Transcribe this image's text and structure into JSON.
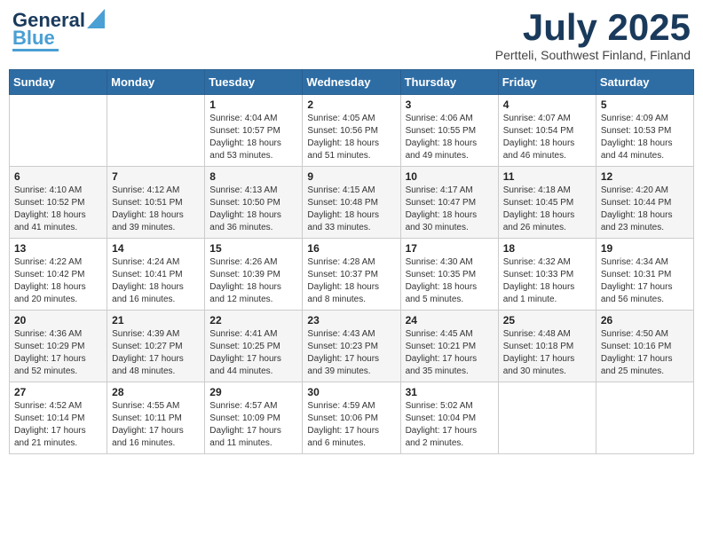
{
  "logo": {
    "line1": "General",
    "line2": "Blue"
  },
  "title": "July 2025",
  "subtitle": "Pertteli, Southwest Finland, Finland",
  "days_header": [
    "Sunday",
    "Monday",
    "Tuesday",
    "Wednesday",
    "Thursday",
    "Friday",
    "Saturday"
  ],
  "weeks": [
    [
      {
        "day": "",
        "info": ""
      },
      {
        "day": "",
        "info": ""
      },
      {
        "day": "1",
        "info": "Sunrise: 4:04 AM\nSunset: 10:57 PM\nDaylight: 18 hours\nand 53 minutes."
      },
      {
        "day": "2",
        "info": "Sunrise: 4:05 AM\nSunset: 10:56 PM\nDaylight: 18 hours\nand 51 minutes."
      },
      {
        "day": "3",
        "info": "Sunrise: 4:06 AM\nSunset: 10:55 PM\nDaylight: 18 hours\nand 49 minutes."
      },
      {
        "day": "4",
        "info": "Sunrise: 4:07 AM\nSunset: 10:54 PM\nDaylight: 18 hours\nand 46 minutes."
      },
      {
        "day": "5",
        "info": "Sunrise: 4:09 AM\nSunset: 10:53 PM\nDaylight: 18 hours\nand 44 minutes."
      }
    ],
    [
      {
        "day": "6",
        "info": "Sunrise: 4:10 AM\nSunset: 10:52 PM\nDaylight: 18 hours\nand 41 minutes."
      },
      {
        "day": "7",
        "info": "Sunrise: 4:12 AM\nSunset: 10:51 PM\nDaylight: 18 hours\nand 39 minutes."
      },
      {
        "day": "8",
        "info": "Sunrise: 4:13 AM\nSunset: 10:50 PM\nDaylight: 18 hours\nand 36 minutes."
      },
      {
        "day": "9",
        "info": "Sunrise: 4:15 AM\nSunset: 10:48 PM\nDaylight: 18 hours\nand 33 minutes."
      },
      {
        "day": "10",
        "info": "Sunrise: 4:17 AM\nSunset: 10:47 PM\nDaylight: 18 hours\nand 30 minutes."
      },
      {
        "day": "11",
        "info": "Sunrise: 4:18 AM\nSunset: 10:45 PM\nDaylight: 18 hours\nand 26 minutes."
      },
      {
        "day": "12",
        "info": "Sunrise: 4:20 AM\nSunset: 10:44 PM\nDaylight: 18 hours\nand 23 minutes."
      }
    ],
    [
      {
        "day": "13",
        "info": "Sunrise: 4:22 AM\nSunset: 10:42 PM\nDaylight: 18 hours\nand 20 minutes."
      },
      {
        "day": "14",
        "info": "Sunrise: 4:24 AM\nSunset: 10:41 PM\nDaylight: 18 hours\nand 16 minutes."
      },
      {
        "day": "15",
        "info": "Sunrise: 4:26 AM\nSunset: 10:39 PM\nDaylight: 18 hours\nand 12 minutes."
      },
      {
        "day": "16",
        "info": "Sunrise: 4:28 AM\nSunset: 10:37 PM\nDaylight: 18 hours\nand 8 minutes."
      },
      {
        "day": "17",
        "info": "Sunrise: 4:30 AM\nSunset: 10:35 PM\nDaylight: 18 hours\nand 5 minutes."
      },
      {
        "day": "18",
        "info": "Sunrise: 4:32 AM\nSunset: 10:33 PM\nDaylight: 18 hours\nand 1 minute."
      },
      {
        "day": "19",
        "info": "Sunrise: 4:34 AM\nSunset: 10:31 PM\nDaylight: 17 hours\nand 56 minutes."
      }
    ],
    [
      {
        "day": "20",
        "info": "Sunrise: 4:36 AM\nSunset: 10:29 PM\nDaylight: 17 hours\nand 52 minutes."
      },
      {
        "day": "21",
        "info": "Sunrise: 4:39 AM\nSunset: 10:27 PM\nDaylight: 17 hours\nand 48 minutes."
      },
      {
        "day": "22",
        "info": "Sunrise: 4:41 AM\nSunset: 10:25 PM\nDaylight: 17 hours\nand 44 minutes."
      },
      {
        "day": "23",
        "info": "Sunrise: 4:43 AM\nSunset: 10:23 PM\nDaylight: 17 hours\nand 39 minutes."
      },
      {
        "day": "24",
        "info": "Sunrise: 4:45 AM\nSunset: 10:21 PM\nDaylight: 17 hours\nand 35 minutes."
      },
      {
        "day": "25",
        "info": "Sunrise: 4:48 AM\nSunset: 10:18 PM\nDaylight: 17 hours\nand 30 minutes."
      },
      {
        "day": "26",
        "info": "Sunrise: 4:50 AM\nSunset: 10:16 PM\nDaylight: 17 hours\nand 25 minutes."
      }
    ],
    [
      {
        "day": "27",
        "info": "Sunrise: 4:52 AM\nSunset: 10:14 PM\nDaylight: 17 hours\nand 21 minutes."
      },
      {
        "day": "28",
        "info": "Sunrise: 4:55 AM\nSunset: 10:11 PM\nDaylight: 17 hours\nand 16 minutes."
      },
      {
        "day": "29",
        "info": "Sunrise: 4:57 AM\nSunset: 10:09 PM\nDaylight: 17 hours\nand 11 minutes."
      },
      {
        "day": "30",
        "info": "Sunrise: 4:59 AM\nSunset: 10:06 PM\nDaylight: 17 hours\nand 6 minutes."
      },
      {
        "day": "31",
        "info": "Sunrise: 5:02 AM\nSunset: 10:04 PM\nDaylight: 17 hours\nand 2 minutes."
      },
      {
        "day": "",
        "info": ""
      },
      {
        "day": "",
        "info": ""
      }
    ]
  ]
}
